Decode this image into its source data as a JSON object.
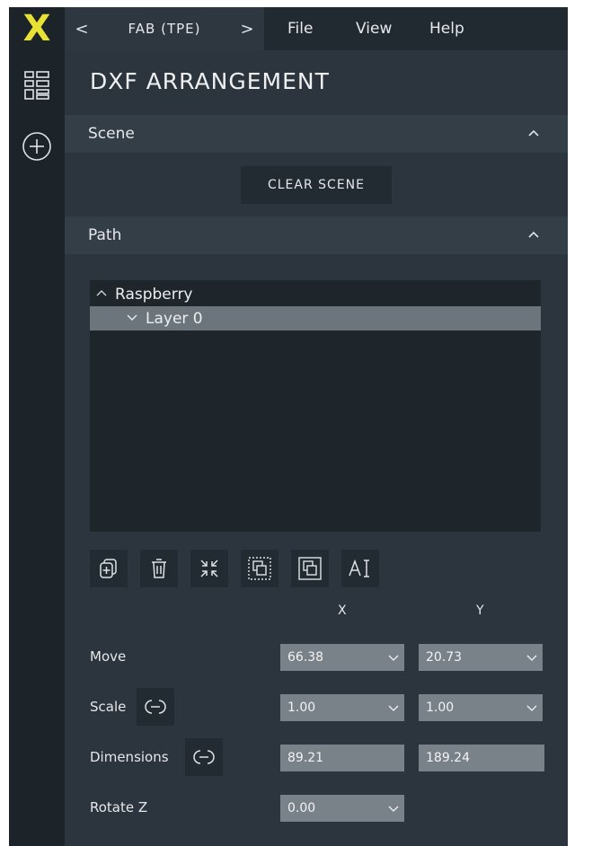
{
  "logo": "X",
  "topbar": {
    "prev": "<",
    "project": "FAB (TPE)",
    "next": ">",
    "menus": [
      "File",
      "View",
      "Help"
    ]
  },
  "panel": {
    "title": "DXF ARRANGEMENT",
    "scene": {
      "label": "Scene",
      "clear_button": "CLEAR SCENE"
    },
    "path": {
      "label": "Path",
      "tree": [
        {
          "label": "Raspberry",
          "expanded": true,
          "selected": false
        },
        {
          "label": "Layer 0",
          "expanded": false,
          "selected": true
        }
      ],
      "tools": [
        "add-icon",
        "delete-icon",
        "collapse-icon",
        "group-icon",
        "ungroup-icon",
        "text-icon"
      ]
    },
    "transform": {
      "x_label": "X",
      "y_label": "Y",
      "move": {
        "label": "Move",
        "x": "66.38",
        "y": "20.73"
      },
      "scale": {
        "label": "Scale",
        "x": "1.00",
        "y": "1.00"
      },
      "dimensions": {
        "label": "Dimensions",
        "x": "89.21",
        "y": "189.24"
      },
      "rotate": {
        "label": "Rotate Z",
        "z": "0.00"
      }
    }
  },
  "colors": {
    "accent": "#e8e234",
    "panel": "#2c353e",
    "rail": "#1c2329",
    "field": "#7a8289"
  }
}
